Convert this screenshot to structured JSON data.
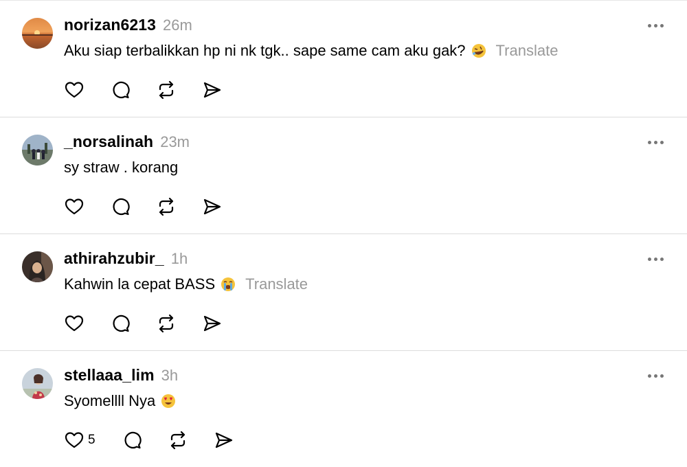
{
  "comments": [
    {
      "username": "norizan6213",
      "time": "26m",
      "text": "Aku siap terbalikkan hp ni nk tgk.. sape same cam aku gak?",
      "emoji": "rolling-on-floor-laughing-emoji",
      "translate": "Translate",
      "likes": ""
    },
    {
      "username": "_norsalinah",
      "time": "23m",
      "text": "sy straw . korang",
      "emoji": "",
      "translate": "",
      "likes": ""
    },
    {
      "username": "athirahzubir_",
      "time": "1h",
      "text": "Kahwin la cepat BASS",
      "emoji": "loudly-crying-face-emoji",
      "translate": "Translate",
      "likes": ""
    },
    {
      "username": "stellaaa_lim",
      "time": "3h",
      "text": "Syomellll Nya",
      "emoji": "heart-eyes-emoji",
      "translate": "",
      "likes": "5"
    }
  ],
  "icons": {
    "like": "heart-icon",
    "reply": "comment-bubble-icon",
    "repost": "repost-icon",
    "share": "send-icon",
    "more": "more-options-icon"
  },
  "colors": {
    "text": "#000000",
    "secondary": "#999999",
    "divider": "#dcdcdc"
  }
}
